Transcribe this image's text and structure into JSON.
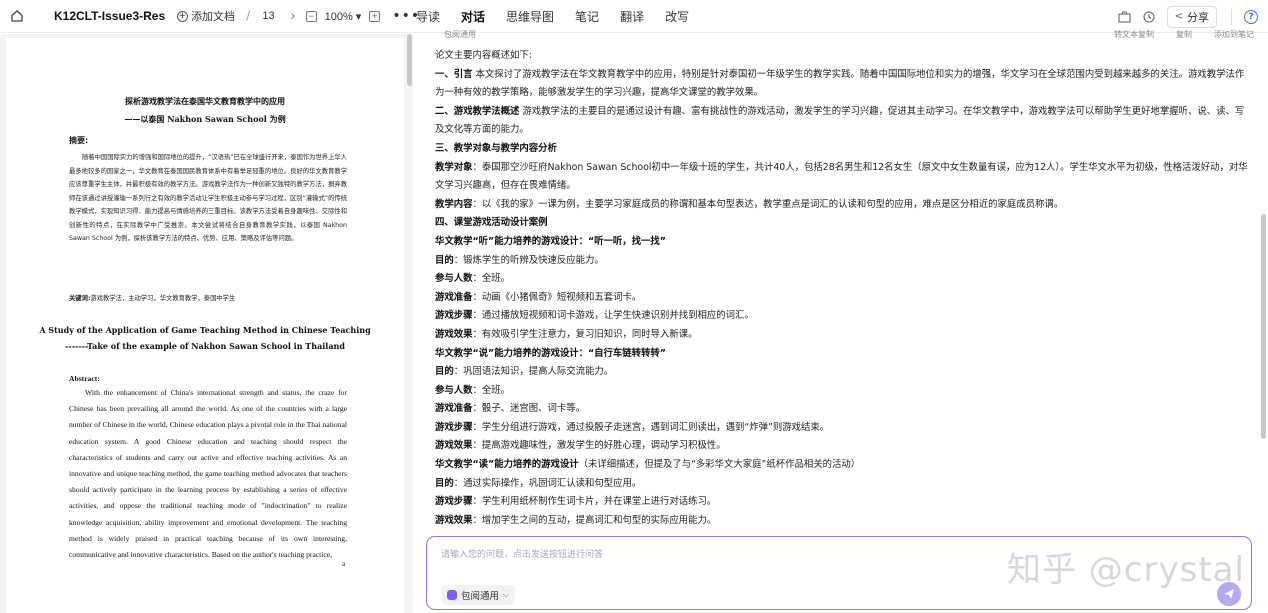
{
  "topbar": {
    "doc_title": "K12CLT-Issue3-Res...",
    "add_doc": "添加文档",
    "page_sep": "/",
    "page_number": "13",
    "zoom": "100%",
    "tabs": [
      "导读",
      "对话",
      "思维导图",
      "笔记",
      "翻译",
      "改写"
    ],
    "active_tab": "对话",
    "share": "分享"
  },
  "paper": {
    "title_zh": "探析游戏教学法在泰国华文教育教学中的应用",
    "subtitle_zh": "——以泰国 Nakhon Sawan School 为例",
    "abstract_label_zh": "摘要:",
    "abstract_zh": "随着中国国际实力的增强和国际地位的提升，“汉语热”已在全球盛行开来，泰国作为世界上华人最多地较多的国家之一，华文教育在泰国国民教育体系中有着举足轻重的地位。良好的华文教育教学应该尊重学生主体，并最积极有效的教学方法。游戏教学法作为一种创新又独特的教学方法，摒弃教师在该通过讲授灌输一系列行之有效的教学活动让学生积极主动参与学习过程，区别“灌输式”的传统教学模式，实现知识习得、能力提高与情感培养的三重目标。该教学方法受着自身趣味性、交际性和创新性的特点，在实际教学中广受推崇。本文尝试将结合自身教育教学实践，以泰国 Nakhon Sawan School 为例，探析该教学方法的特点、优势、应用、策略及评估等问题。",
    "keywords_label_zh": "关键词:",
    "keywords_zh": "游戏教学法，主动学习，华文教育教学，泰国中学生",
    "title_en": "A Study of the Application of Game Teaching Method in Chinese Teaching",
    "subtitle_en": "-------Take of the example of Nakhon Sawan School in Thailand",
    "abstract_label_en": "Abstract:",
    "abstract_en": "With the enhancement of China's international strength and status, the craze for Chinese has been prevailing all around the world. As one of the countries with a large number of Chinese in the world, Chinese education plays a pivotal role in the Thai national education system. A good Chinese education and teaching should respect the characteristics of students and carry out active and effective teaching activities. As an innovative and unique teaching method, the game teaching method advocates that teachers should actively participate in the learning process by establishing a series of effective activities, and oppose the traditional teaching mode of \"indoctrination\" to realize knowledge acquisition, ability improvement and emotional development. The teaching method is widely praised in practical teaching because of its own interesting, communicative and innovative characteristics. Based on the author's teaching practice,",
    "page_mark": "a"
  },
  "chat": {
    "top_left": "包阅通用",
    "top_right": [
      "转文本复制",
      "复制",
      "添加到笔记"
    ],
    "lines": [
      {
        "t": "论文主要内容概述如下:"
      },
      {
        "b": "一、引言",
        "t": " 本文探讨了游戏教学法在华文教育教学中的应用，特别是针对泰国初一年级学生的教学实践。随着中国国际地位和实力的增强，华文学习在全球范围内受到越来越多的关注。游戏教学法作为一种有效的教学策略，能够激发学生的学习兴趣，提高华文课堂的教学效果。"
      },
      {
        "b": "二、游戏教学法概述",
        "t": " 游戏教学法的主要目的是通过设计有趣、富有挑战性的游戏活动，激发学生的学习兴趣，促进其主动学习。在华文教学中，游戏教学法可以帮助学生更好地掌握听、说、读、写及文化等方面的能力。"
      },
      {
        "b": "三、教学对象与教学内容分析"
      },
      {
        "b": "教学对象",
        "t": "：泰国那空沙旺府Nakhon Sawan School初中一年级十班的学生，共计40人，包括28名男生和12名女生（原文中女生数量有误，应为12人）。学生华文水平为初级，性格活泼好动，对华文学习兴趣高，但存在畏难情绪。"
      },
      {
        "b": "教学内容",
        "t": "：以《我的家》一课为例，主要学习家庭成员的称谓和基本句型表达，教学重点是词汇的认读和句型的应用，难点是区分相近的家庭成员称谓。"
      },
      {
        "b": "四、课堂游戏活动设计案例"
      },
      {
        "b": "华文教学“听”能力培养的游戏设计：“听一听，找一找”"
      },
      {
        "b": "目的",
        "t": "：锻炼学生的听辨及快速反应能力。"
      },
      {
        "b": "参与人数",
        "t": "：全班。"
      },
      {
        "b": "游戏准备",
        "t": "：动画《小猪佩奇》短视频和五套词卡。"
      },
      {
        "b": "游戏步骤",
        "t": "：通过播放短视频和词卡游戏，让学生快速识别并找到相应的词汇。"
      },
      {
        "b": "游戏效果",
        "t": "：有效吸引学生注意力，复习旧知识，同时导入新课。"
      },
      {
        "b": "华文教学“说”能力培养的游戏设计：“自行车链转转转”"
      },
      {
        "b": "目的",
        "t": "：巩固语法知识，提高人际交流能力。"
      },
      {
        "b": "参与人数",
        "t": "：全班。"
      },
      {
        "b": "游戏准备",
        "t": "：骰子、迷宫图、词卡等。"
      },
      {
        "b": "游戏步骤",
        "t": "：学生分组进行游戏，通过投骰子走迷宫，遇到词汇则读出，遇到“炸弹”则游戏结束。"
      },
      {
        "b": "游戏效果",
        "t": "：提高游戏趣味性，激发学生的好胜心理，调动学习积极性。"
      },
      {
        "b": "华文教学“读”能力培养的游戏设计",
        "t": "（未详细描述，但提及了与“多彩华文大家庭”纸杯作品相关的活动）"
      },
      {
        "b": "目的",
        "t": "：通过实际操作，巩固词汇认读和句型应用。"
      },
      {
        "b": "游戏步骤",
        "t": "：学生利用纸杯制作生词卡片，并在课堂上进行对话练习。"
      },
      {
        "b": "游戏效果",
        "t": "：增加学生之间的互动，提高词汇和句型的实际应用能力。"
      }
    ],
    "input_placeholder": "请输入您的问题，点击发送按钮进行问答",
    "mode_label": "包阅通用",
    "watermark": "知乎 @crystal"
  }
}
